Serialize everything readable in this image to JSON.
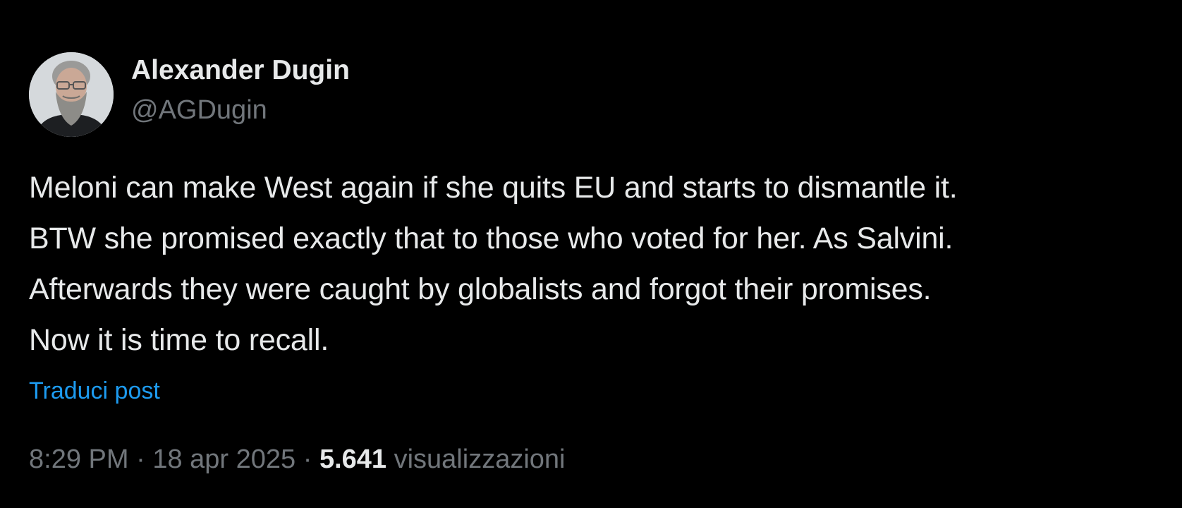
{
  "author": {
    "display_name": "Alexander Dugin",
    "handle": "@AGDugin"
  },
  "post": {
    "lines": [
      "Meloni can make West again if she quits EU and starts to dismantle it.",
      "BTW she promised exactly that to those who voted for her. As Salvini.",
      "Afterwards they were caught by globalists and forgot their promises.",
      "Now it is time to recall."
    ],
    "translate_label": "Traduci post"
  },
  "meta": {
    "time": "8:29 PM",
    "separator": "·",
    "date": "18 apr 2025",
    "views_count": "5.641",
    "views_label": "visualizzazioni"
  },
  "colors": {
    "background": "#000000",
    "primary_text": "#e7e9ea",
    "secondary_text": "#71767b",
    "link": "#1d9bf0"
  }
}
